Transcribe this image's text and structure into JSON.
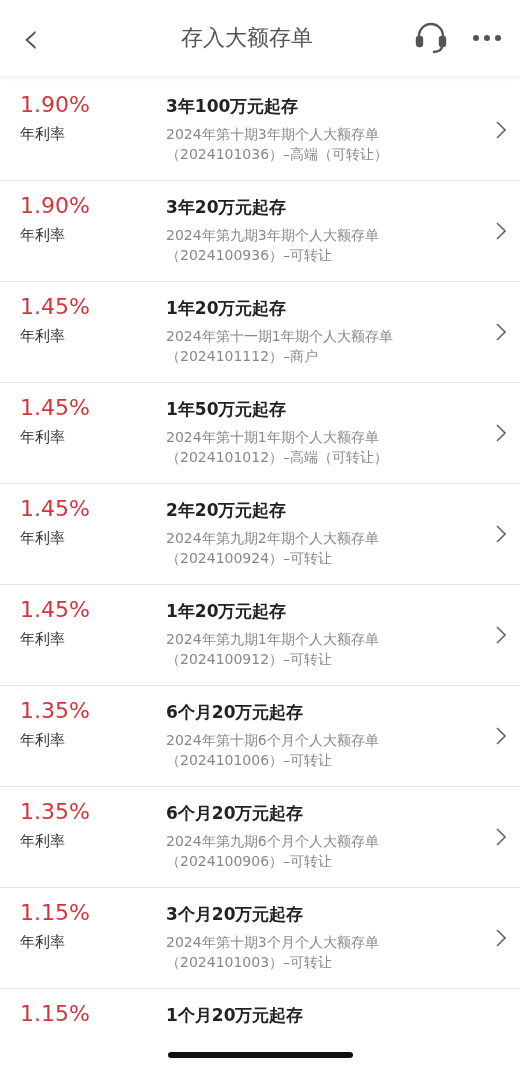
{
  "header": {
    "back": "‹",
    "title": "存入大额存单"
  },
  "products": [
    {
      "rate": "1.90%",
      "rate_label": "年利率",
      "title": "3年100万元起存",
      "desc": [
        "2024年第十期3年期个人大额存单",
        "（2024101036）–高端（可转让）"
      ]
    },
    {
      "rate": "1.90%",
      "rate_label": "年利率",
      "title": "3年20万元起存",
      "desc": [
        "2024年第九期3年期个人大额存单",
        "（2024100936）–可转让"
      ]
    },
    {
      "rate": "1.45%",
      "rate_label": "年利率",
      "title": "1年20万元起存",
      "desc": [
        "2024年第十一期1年期个人大额存单",
        "（2024101112）–商户"
      ]
    },
    {
      "rate": "1.45%",
      "rate_label": "年利率",
      "title": "1年50万元起存",
      "desc": [
        "2024年第十期1年期个人大额存单",
        "（2024101012）–高端（可转让）"
      ]
    },
    {
      "rate": "1.45%",
      "rate_label": "年利率",
      "title": "2年20万元起存",
      "desc": [
        "2024年第九期2年期个人大额存单",
        "（2024100924）–可转让"
      ]
    },
    {
      "rate": "1.45%",
      "rate_label": "年利率",
      "title": "1年20万元起存",
      "desc": [
        "2024年第九期1年期个人大额存单",
        "（2024100912）–可转让"
      ]
    },
    {
      "rate": "1.35%",
      "rate_label": "年利率",
      "title": "6个月20万元起存",
      "desc": [
        "2024年第十期6个月个人大额存单",
        "（2024101006）–可转让"
      ]
    },
    {
      "rate": "1.35%",
      "rate_label": "年利率",
      "title": "6个月20万元起存",
      "desc": [
        "2024年第九期6个月个人大额存单",
        "（2024100906）–可转让"
      ]
    },
    {
      "rate": "1.15%",
      "rate_label": "年利率",
      "title": "3个月20万元起存",
      "desc": [
        "2024年第十期3个月个人大额存单",
        "（2024101003）–可转让"
      ]
    },
    {
      "rate": "1.15%",
      "title": "1个月20万元起存"
    }
  ]
}
